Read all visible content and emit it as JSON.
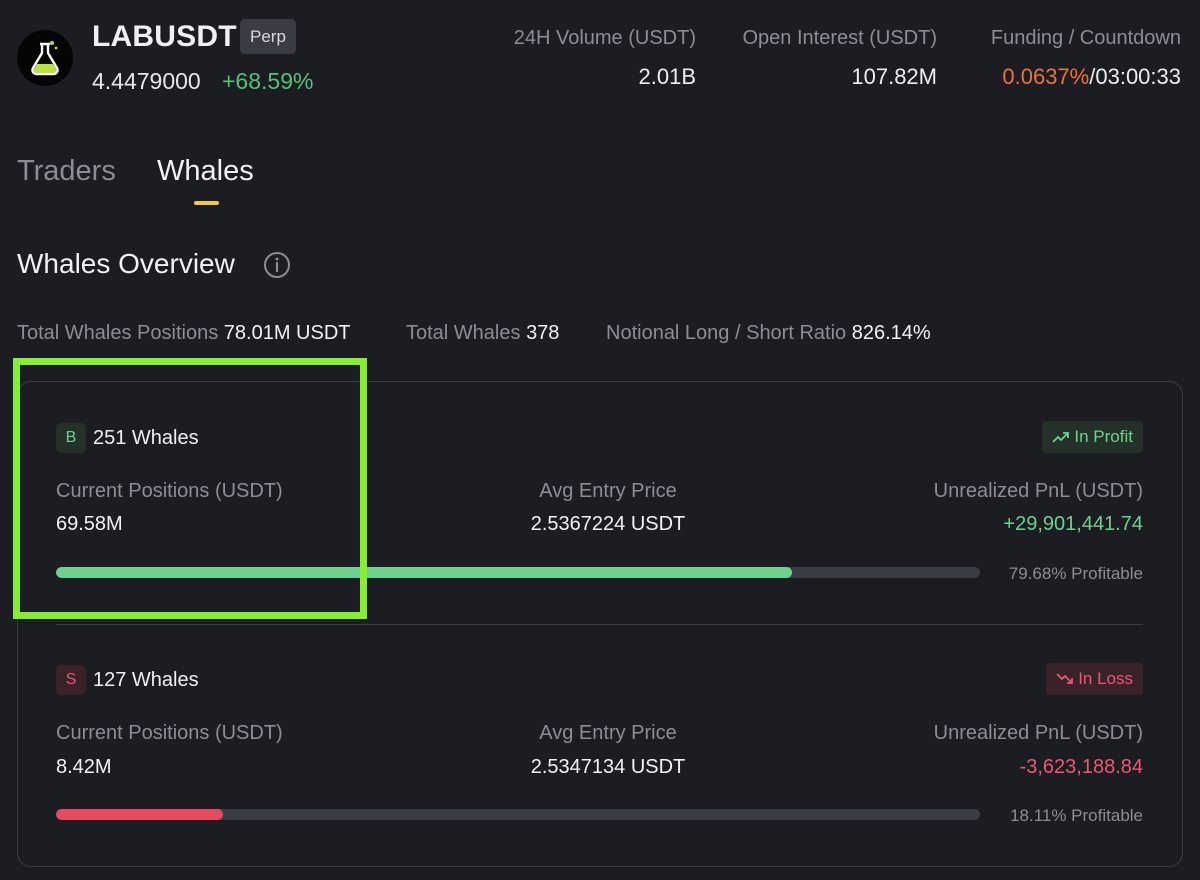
{
  "header": {
    "symbol": "LABUSDT",
    "contract_type": "Perp",
    "price": "4.4479000",
    "change": "+68.59%",
    "logo_icon": "flask-icon",
    "stats": {
      "volume_label": "24H Volume (USDT)",
      "volume_value": "2.01B",
      "open_interest_label": "Open Interest (USDT)",
      "open_interest_value": "107.82M",
      "funding_label": "Funding / Countdown",
      "funding_rate": "0.0637%",
      "funding_separator": "/",
      "countdown": "03:00:33"
    }
  },
  "tabs": [
    {
      "label": "Traders",
      "active": false
    },
    {
      "label": "Whales",
      "active": true
    }
  ],
  "overview": {
    "title": "Whales Overview",
    "info_icon": "info-icon",
    "summary": {
      "positions_label": "Total Whales Positions",
      "positions_value": "78.01M USDT",
      "whales_label": "Total Whales",
      "whales_value": "378",
      "ratio_label": "Notional Long / Short Ratio",
      "ratio_value": "826.14%"
    }
  },
  "sides": [
    {
      "side_letter": "B",
      "whale_count": "251 Whales",
      "status_icon": "trending-up-icon",
      "status": "In Profit",
      "positions_label": "Current Positions (USDT)",
      "positions_value": "69.58M",
      "entry_label": "Avg Entry Price",
      "entry_value": "2.5367224 USDT",
      "pnl_label": "Unrealized PnL (USDT)",
      "pnl_value": "+29,901,441.74",
      "profitable_pct": 79.68,
      "profitable_text": "79.68% Profitable"
    },
    {
      "side_letter": "S",
      "whale_count": "127 Whales",
      "status_icon": "trending-down-icon",
      "status": "In Loss",
      "positions_label": "Current Positions (USDT)",
      "positions_value": "8.42M",
      "entry_label": "Avg Entry Price",
      "entry_value": "2.5347134 USDT",
      "pnl_label": "Unrealized PnL (USDT)",
      "pnl_value": "-3,623,188.84",
      "profitable_pct": 18.11,
      "profitable_text": "18.11% Profitable"
    }
  ],
  "colors": {
    "background": "#1c1d22",
    "positive": "#6dd28d",
    "negative": "#f0566e",
    "funding": "#f0703f",
    "tab_accent": "#f0c94a",
    "highlight": "#88ee34"
  }
}
